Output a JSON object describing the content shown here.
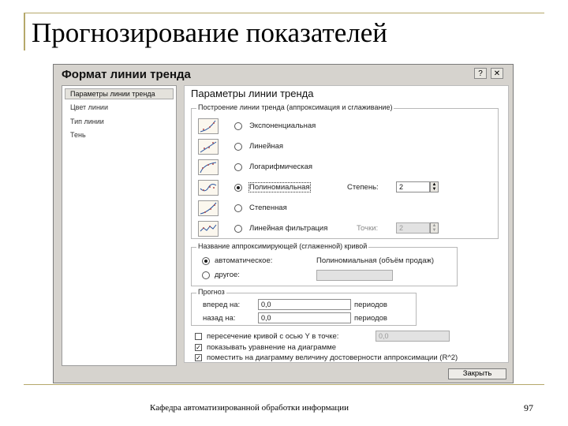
{
  "slide": {
    "title": "Прогнозирование  показателей",
    "footer": "Кафедра автоматизированной обработки информации",
    "page_number": "97"
  },
  "dialog": {
    "title": "Формат линии тренда",
    "help_button": "?",
    "close_x": "✕",
    "nav": [
      "Параметры линии тренда",
      "Цвет линии",
      "Тип линии",
      "Тень"
    ],
    "section_title": "Параметры линии тренда",
    "build_group": {
      "legend": "Построение линии тренда (аппроксимация и сглаживание)",
      "options": [
        {
          "label": "Экспоненциальная",
          "selected": false
        },
        {
          "label": "Линейная",
          "selected": false
        },
        {
          "label": "Логарифмическая",
          "selected": false
        },
        {
          "label": "Полиномиальная",
          "selected": true
        },
        {
          "label": "Степенная",
          "selected": false
        },
        {
          "label": "Линейная фильтрация",
          "selected": false
        }
      ],
      "degree_label": "Степень:",
      "degree_value": "2",
      "points_label": "Точки:",
      "points_value": "2"
    },
    "name_group": {
      "legend": "Название аппроксимирующей (сглаженной) кривой",
      "auto_label": "автоматическое:",
      "auto_value": "Полиномиальная (объём продаж)",
      "custom_label": "другое:",
      "auto_selected": true
    },
    "forecast_group": {
      "legend": "Прогноз",
      "forward_label": "вперед на:",
      "forward_value": "0,0",
      "backward_label": "назад на:",
      "backward_value": "0,0",
      "periods_label": "периодов"
    },
    "checkboxes": [
      {
        "label": "пересечение кривой с осью Y в точке:",
        "checked": false
      },
      {
        "label": "показывать уравнение на диаграмме",
        "checked": true
      },
      {
        "label": "поместить на диаграмму величину достоверности аппроксимации (R^2)",
        "checked": true
      }
    ],
    "intercept_value": "0,0",
    "close_button": "Закрыть"
  }
}
